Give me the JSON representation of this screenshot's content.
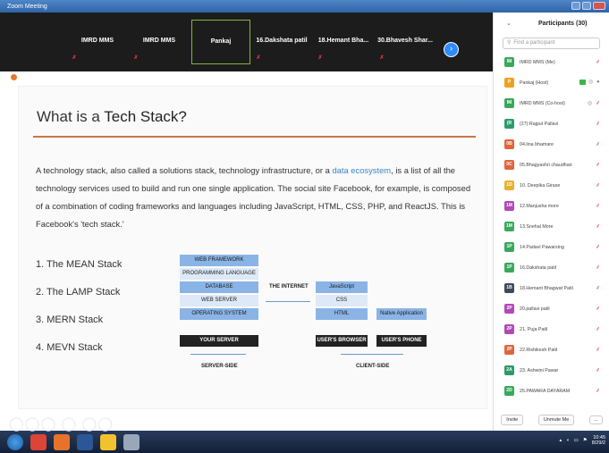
{
  "window": {
    "title": "Zoom Meeting"
  },
  "videos": [
    {
      "name": "IMRD MMS",
      "muted": true,
      "active": false
    },
    {
      "name": "IMRD MMS",
      "muted": true,
      "active": false
    },
    {
      "name": "Pankaj",
      "muted": false,
      "active": true
    },
    {
      "name": "16.Dakshata patil",
      "muted": true,
      "active": false
    },
    {
      "name": "18.Hemant Bha...",
      "muted": true,
      "active": false
    },
    {
      "name": "30.Bhavesh Shar...",
      "muted": true,
      "active": false
    }
  ],
  "next_icon": "chevron-right-icon",
  "slide": {
    "title_prefix": "What is a ",
    "title_bold": "Tech Stack?",
    "para_before": "A technology stack, also called a solutions stack, technology infrastructure, or a ",
    "para_link": "data ecosystem",
    "para_after": ", is a list of all the technology services used to build and run one single application. The social site Facebook, for example, is composed of a combination of coding frameworks and languages including JavaScript, HTML, CSS, PHP, and ReactJS. This is Facebook's 'tech stack.'",
    "stacks": [
      "1. The MEAN Stack",
      "2. The LAMP Stack",
      "3. MERN Stack",
      "4. MEVN Stack"
    ],
    "diagram": {
      "server_boxes": [
        "WEB FRAMEWORK",
        "PROGRAMMING LANGUAGE",
        "DATABASE",
        "WEB SERVER",
        "OPERATING SYSTEM"
      ],
      "internet_label": "THE INTERNET",
      "client_boxes": [
        "JavaScript",
        "CSS",
        "HTML"
      ],
      "native_label": "Native Application",
      "your_server": "YOUR SERVER",
      "users_browser": "USER'S BROWSER",
      "users_phone": "USER'S PHONE",
      "server_side": "SERVER-SIDE",
      "client_side": "CLIENT-SIDE"
    }
  },
  "panel": {
    "title": "Participants (30)",
    "search_placeholder": "Find a participant",
    "invite_label": "Invite",
    "unmute_label": "Unmute Me",
    "more_label": "...",
    "participants": [
      {
        "initials": "IM",
        "name": "IMRD MMS (Me)",
        "color": "#3aa85b",
        "icons": [
          "mic-muted"
        ]
      },
      {
        "initials": "P",
        "name": "Pankaj (Host)",
        "color": "#f0a020",
        "icons": [
          "video",
          "share",
          "mic"
        ]
      },
      {
        "initials": "IM",
        "name": "IMRD MMS (Co-host)",
        "color": "#3aa85b",
        "icons": [
          "share",
          "mic-muted"
        ]
      },
      {
        "initials": "(R",
        "name": "(27) Rajput Pallavi",
        "color": "#2e9a6b",
        "icons": [
          "mic-muted"
        ]
      },
      {
        "initials": "0B",
        "name": "04.lina bhamare",
        "color": "#e0663a",
        "icons": [
          "mic-muted"
        ]
      },
      {
        "initials": "0C",
        "name": "05.Bhagyashri chaudhari",
        "color": "#e0663a",
        "icons": [
          "mic-muted"
        ]
      },
      {
        "initials": "1D",
        "name": "10. Deepika Girase",
        "color": "#e8b230",
        "icons": [
          "mic-muted"
        ]
      },
      {
        "initials": "1M",
        "name": "12.Manjusha more",
        "color": "#b04ab6",
        "icons": [
          "mic-muted"
        ]
      },
      {
        "initials": "1M",
        "name": "13.Snehal More",
        "color": "#3aa85b",
        "icons": [
          "mic-muted"
        ]
      },
      {
        "initials": "1P",
        "name": "14.Padavi Pawarsing",
        "color": "#3aa85b",
        "icons": [
          "mic-muted"
        ]
      },
      {
        "initials": "1P",
        "name": "16.Dakshata patil",
        "color": "#3aa85b",
        "icons": [
          "mic-muted"
        ]
      },
      {
        "initials": "1B",
        "name": "18.Hemant Bhagwat Patil",
        "color": "#3d4a5a",
        "icons": [
          "mic-muted"
        ]
      },
      {
        "initials": "2P",
        "name": "20.pallavi  patil",
        "color": "#b04ab6",
        "icons": [
          "mic-muted"
        ]
      },
      {
        "initials": "2P",
        "name": "21. Puja Patil",
        "color": "#b04ab6",
        "icons": [
          "mic-muted"
        ]
      },
      {
        "initials": "2P",
        "name": "22.Rishikesh Patil",
        "color": "#e0663a",
        "icons": [
          "mic-muted"
        ]
      },
      {
        "initials": "2A",
        "name": "23. Ashwini Pawar",
        "color": "#2e9a6b",
        "icons": [
          "mic-muted"
        ]
      },
      {
        "initials": "2D",
        "name": "25.PAWARA DAYARAM",
        "color": "#3aa85b",
        "icons": [
          "mic-muted"
        ]
      }
    ]
  },
  "taskbar": {
    "clock_time": "10:45",
    "clock_date": "8/29/2",
    "icons": [
      {
        "name": "chrome-icon",
        "color": "#db4437"
      },
      {
        "name": "firefox-icon",
        "color": "#e8722a"
      },
      {
        "name": "word-icon",
        "color": "#2b5797"
      },
      {
        "name": "notes-icon",
        "color": "#f2c12e"
      },
      {
        "name": "zoom-icon",
        "color": "#9aa7b8"
      }
    ]
  }
}
